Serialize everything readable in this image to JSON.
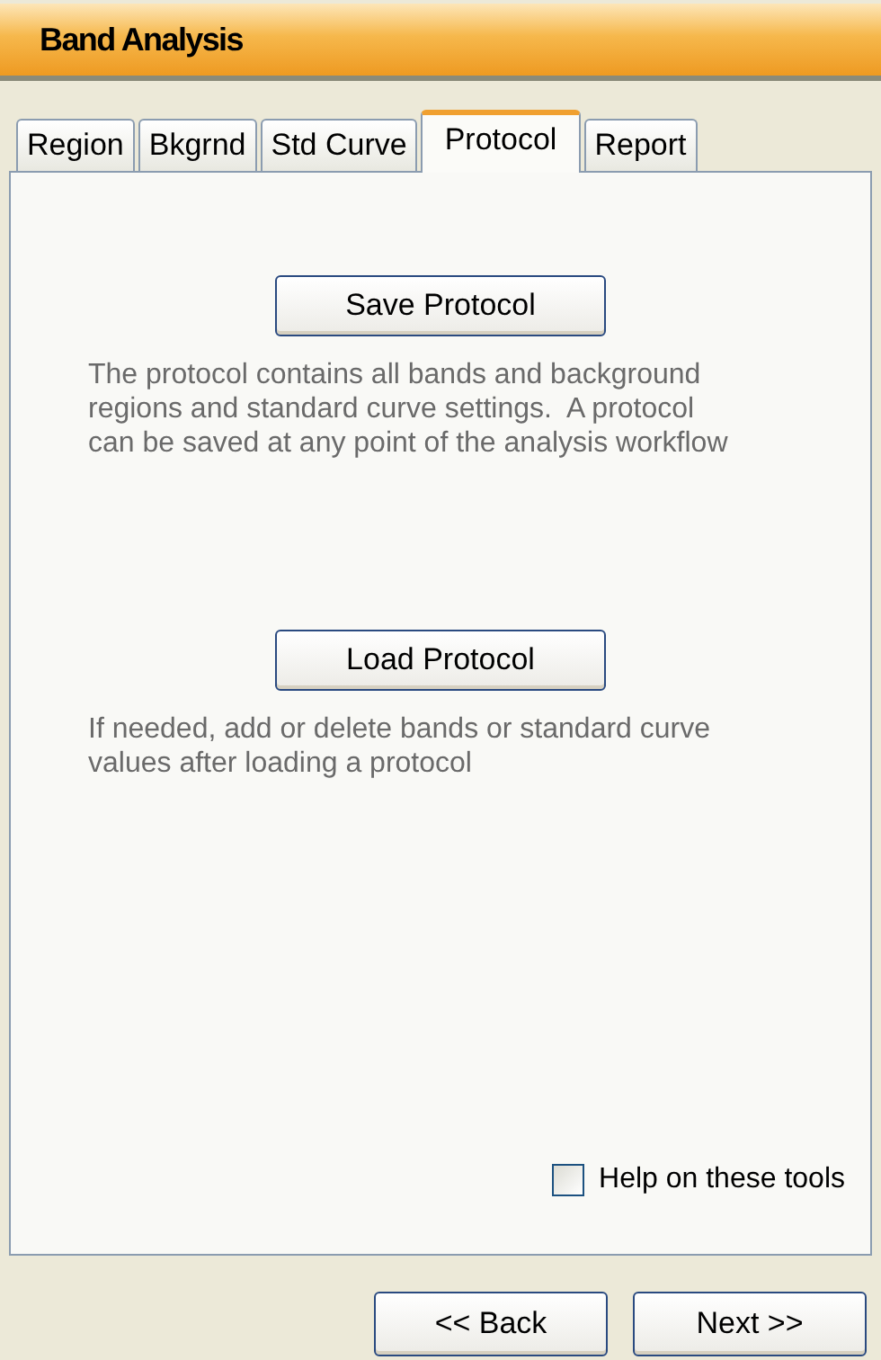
{
  "window": {
    "title": "Band Analysis"
  },
  "tabs": [
    {
      "label": "Region",
      "selected": false
    },
    {
      "label": "Bkgrnd",
      "selected": false
    },
    {
      "label": "Std Curve",
      "selected": false
    },
    {
      "label": "Protocol",
      "selected": true
    },
    {
      "label": "Report",
      "selected": false
    }
  ],
  "sections": [
    {
      "button": "Save Protocol",
      "description": "The protocol contains all bands and background regions and standard curve settings.  A protocol can be saved at any point of the analysis workflow"
    },
    {
      "button": "Load Protocol",
      "description": "If needed, add or delete bands or standard curve values after loading a protocol"
    }
  ],
  "help_checkbox": {
    "label": "Help on these tools",
    "checked": false
  },
  "nav_buttons": [
    "<< Back",
    "Next >>"
  ]
}
